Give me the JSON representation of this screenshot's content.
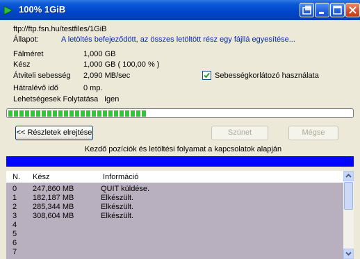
{
  "window": {
    "title": "100% 1GiB"
  },
  "info": {
    "url": "ftp://ftp.fsn.hu/testfiles/1GiB",
    "status_label": "Állapot:",
    "status_value": "A letöltés befejeződött, az összes letöltött rész egy fájllá egyesítése...",
    "filesize_label": "Fálméret",
    "filesize_value": "1,000  GB",
    "done_label": "Kész",
    "done_value": "1,000  GB  ( 100,00 % )",
    "speed_label": "Átviteli sebesség",
    "speed_value": "2,090  MB/sec",
    "remaining_label": "Hátralévő idő",
    "remaining_value": "0 mp.",
    "resume_label": "Lehetségesek Folytatása",
    "resume_value": "Igen",
    "speed_limit_label": "Sebességkorlátozó használata",
    "speed_limit_checked": true
  },
  "progress": {
    "fraction": 0.33,
    "segments": 25,
    "color": "#3bc03b"
  },
  "buttons": {
    "hide_details": "<< Részletek elrejtése",
    "pause": "Szünet",
    "cancel": "Mégse"
  },
  "connections": {
    "caption": "Kezdő pozíciók és letöltési folyamat a kapcsolatok alapján",
    "bar_color": "#0005ff"
  },
  "list": {
    "headers": {
      "n": "N.",
      "done": "Kész",
      "info": "Információ"
    },
    "rows": [
      {
        "n": "0",
        "done": "247,860  MB",
        "info": "QUIT küldése."
      },
      {
        "n": "1",
        "done": "182,187  MB",
        "info": "Elkészült."
      },
      {
        "n": "2",
        "done": "285,344  MB",
        "info": "Elkészült."
      },
      {
        "n": "3",
        "done": "308,604  MB",
        "info": "Elkészült."
      },
      {
        "n": "4",
        "done": "",
        "info": ""
      },
      {
        "n": "5",
        "done": "",
        "info": ""
      },
      {
        "n": "6",
        "done": "",
        "info": ""
      },
      {
        "n": "7",
        "done": "",
        "info": ""
      }
    ]
  }
}
